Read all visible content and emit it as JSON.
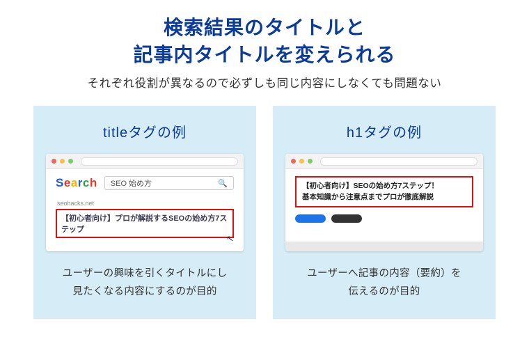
{
  "heading": {
    "title_line1": "検索結果のタイトルと",
    "title_line2": "記事内タイトルを変えられる",
    "subtitle": "それぞれ役割が異なるので必ずしも同じ内容にしなくても問題ない"
  },
  "left": {
    "card_title": "titleタグの例",
    "logo": "Search",
    "search_query": "SEO 始め方",
    "serp_site": "seohacks.net",
    "serp_title": "【初心者向け】プロが解説するSEOの始め方7ステップ",
    "desc_line1": "ユーザーの興味を引くタイトルにし",
    "desc_line2": "見たくなる内容にするのが目的"
  },
  "right": {
    "card_title": "h1タグの例",
    "h1_line1": "【初心者向け】SEOの始め方7ステップ！",
    "h1_line2": "基本知識から注意点までプロが徹底解説",
    "desc_line1": "ユーザーへ記事の内容（要約）を",
    "desc_line2": "伝えるのが目的"
  }
}
